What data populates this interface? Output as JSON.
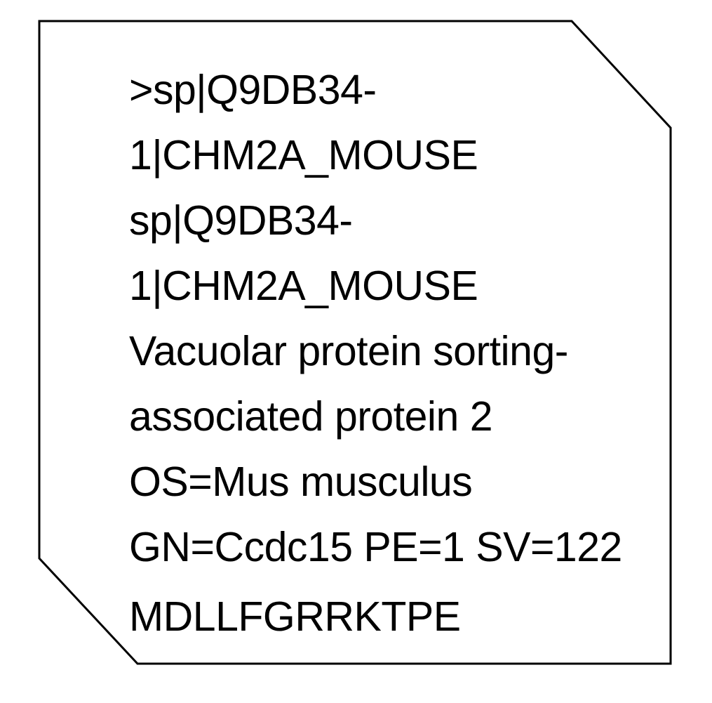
{
  "card": {
    "border_color": "#000000",
    "background_color": "#ffffff",
    "lines": [
      ">sp|Q9DB34-",
      "1|CHM2A_MOUSE",
      "sp|Q9DB34-",
      "1|CHM2A_MOUSE",
      "Vacuolar protein sorting-",
      "associated protein 2",
      "OS=Mus musculus",
      "GN=Ccdc15 PE=1 SV=122"
    ],
    "sequence": "MDLLFGRRKTPE"
  }
}
